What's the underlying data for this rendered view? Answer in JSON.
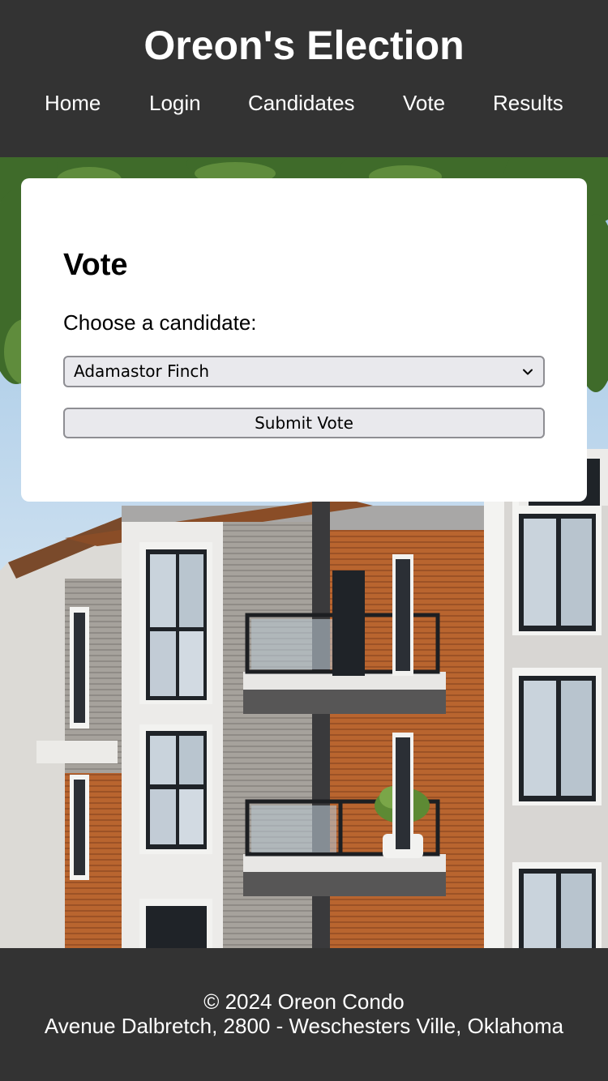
{
  "header": {
    "title": "Oreon's Election",
    "nav": [
      {
        "label": "Home"
      },
      {
        "label": "Login"
      },
      {
        "label": "Candidates"
      },
      {
        "label": "Vote"
      },
      {
        "label": "Results"
      }
    ]
  },
  "vote_form": {
    "heading": "Vote",
    "choose_label": "Choose a candidate:",
    "selected_candidate": "Adamastor Finch",
    "submit_label": "Submit Vote"
  },
  "footer": {
    "copyright": "© 2024 Oreon Condo",
    "address": "Avenue Dalbretch, 2800 - Weschesters Ville, Oklahoma"
  },
  "colors": {
    "header_bg": "#333333",
    "footer_bg": "#333333",
    "card_bg": "#ffffff",
    "control_bg": "#e9e9ed"
  },
  "icons": {
    "select_arrow": "chevron-down-icon"
  }
}
